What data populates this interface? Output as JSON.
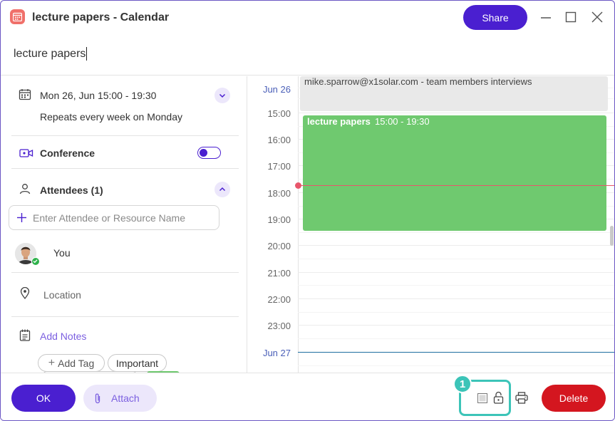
{
  "window": {
    "title": "lecture papers - Calendar",
    "share_label": "Share"
  },
  "event_title_value": "lecture papers",
  "details": {
    "datetime": "Mon 26, Jun 15:00 - 19:30",
    "repeat": "Repeats every week on Monday",
    "conference_label": "Conference",
    "conference_enabled": true,
    "attendees_label": "Attendees (1)",
    "attendee_placeholder": "Enter Attendee or Resource Name",
    "attendees": [
      {
        "name": "You",
        "status": "accepted"
      }
    ],
    "location_placeholder": "Location",
    "notes_label": "Add Notes",
    "add_tag_label": "Add Tag",
    "tags": [
      "Important"
    ]
  },
  "calendar": {
    "date_top": "Jun 26",
    "date_bottom": "Jun 27",
    "hours": [
      "15:00",
      "16:00",
      "17:00",
      "18:00",
      "19:00",
      "20:00",
      "21:00",
      "22:00",
      "23:00"
    ],
    "allday_event": "mike.sparrow@x1solar.com - team members interviews",
    "event_title": "lecture papers",
    "event_time": "15:00 - 19:30",
    "event_color": "#6fc96f",
    "now_line_color": "#e8566b"
  },
  "footer": {
    "ok_label": "OK",
    "attach_label": "Attach",
    "delete_label": "Delete",
    "highlight_number": "1"
  },
  "colors": {
    "accent": "#4a1fd0",
    "danger": "#d4161f",
    "highlight": "#3cc4b8"
  }
}
